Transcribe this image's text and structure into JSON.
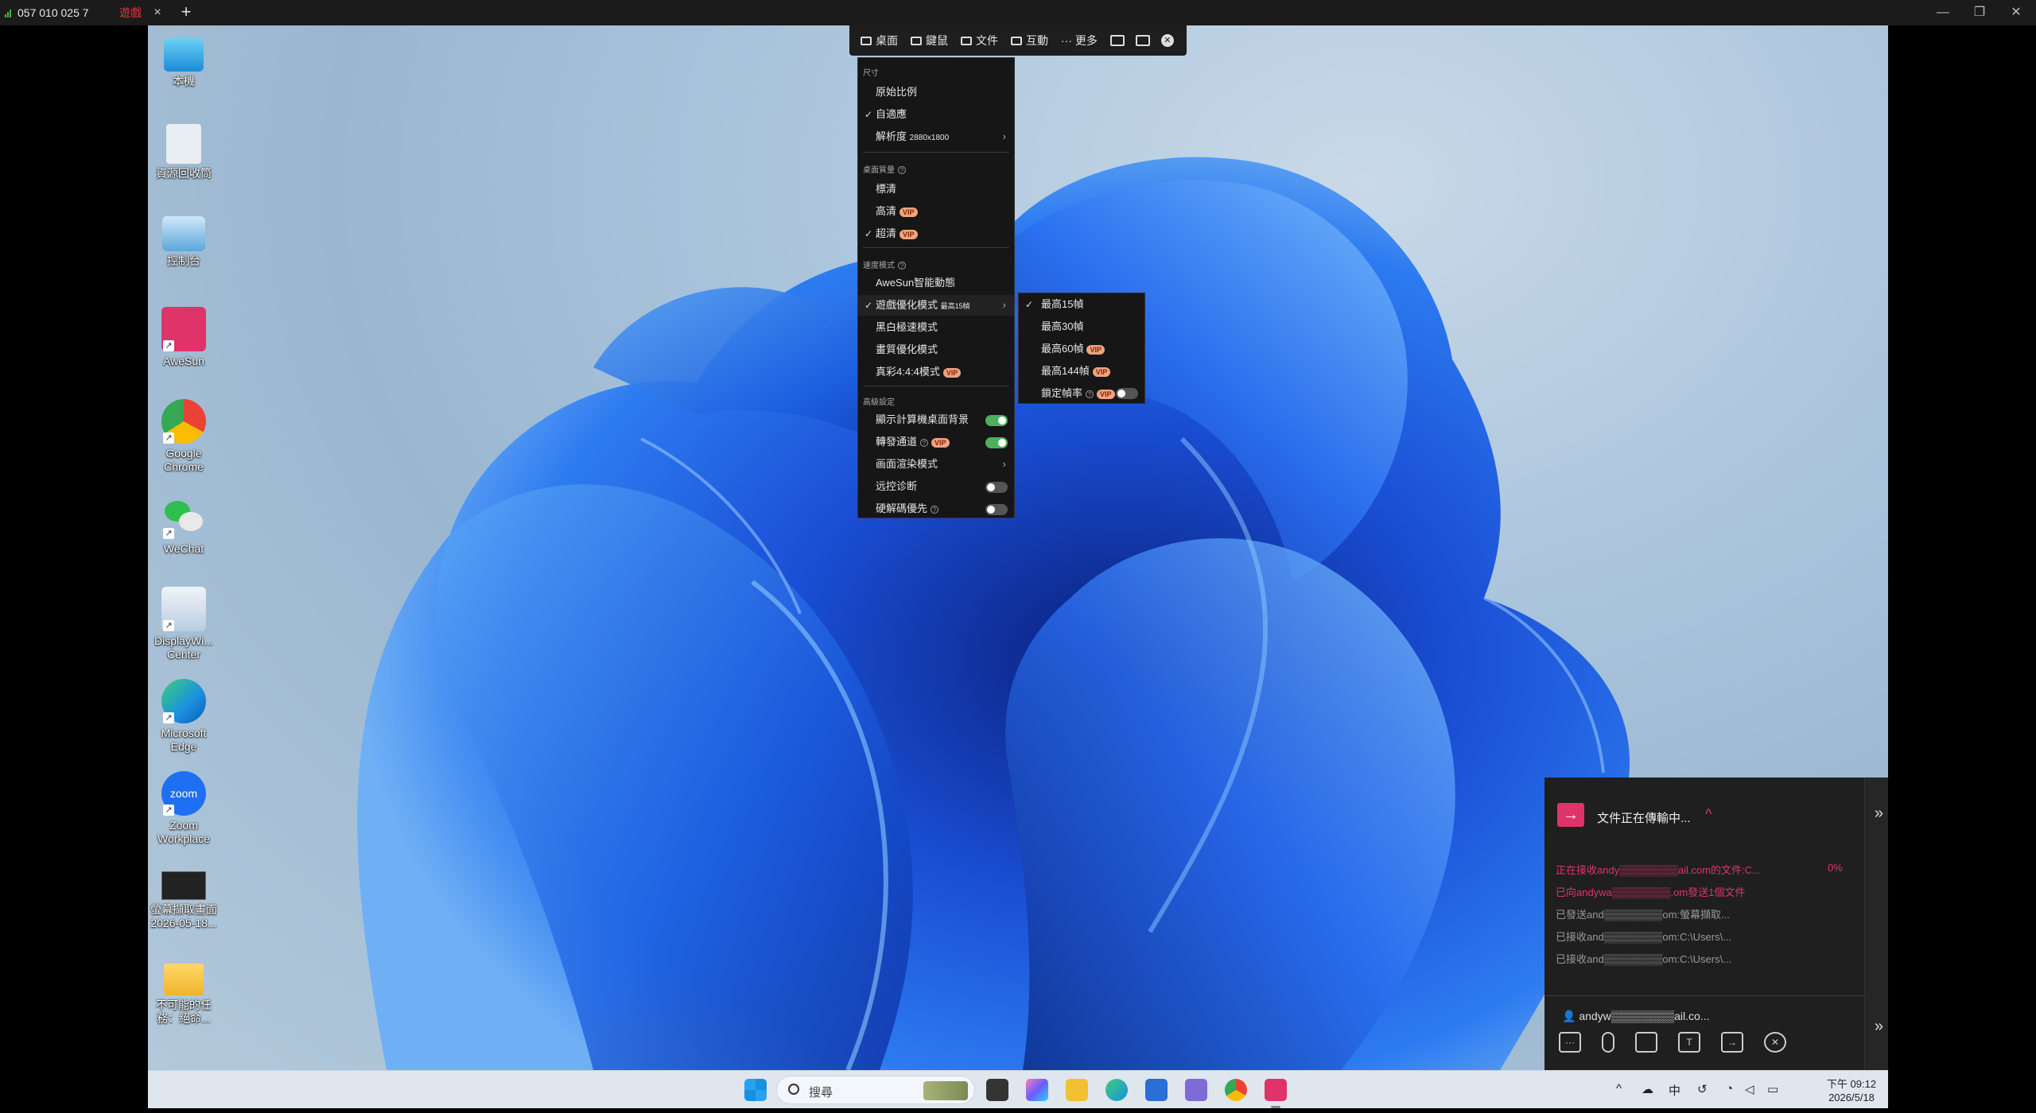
{
  "titlebar": {
    "connection_id": "057 010 025 7",
    "game_tab": "遊戲",
    "close_tab": "×",
    "add_tab": "+",
    "minimize": "—",
    "restore": "❐",
    "close": "✕"
  },
  "toolbar": {
    "desktop": "桌面",
    "keyboard": "鍵鼠",
    "file": "文件",
    "interact": "互動",
    "more": "··· 更多"
  },
  "menu": {
    "size_section": "尺寸",
    "original_ratio": "原始比例",
    "adaptive": "自適應",
    "resolution": "解析度",
    "resolution_value": "2880x1800",
    "quality_section": "桌面質量",
    "standard": "標清",
    "hd": "高清",
    "ultra_hd": "超清",
    "vip": "VIP",
    "speed_section": "速度模式",
    "awesun_smart": "AweSun智能動態",
    "game_mode": "遊戲優化模式",
    "game_mode_value": "最高15幀",
    "bw_mode": "黑白極速模式",
    "quality_mode": "畫質優化模式",
    "true_color": "真彩4:4:4模式",
    "advanced_section": "高級設定",
    "show_wallpaper": "顯示計算機桌面背景",
    "relay": "轉發通道",
    "render_mode": "画面渲染模式",
    "remote_diag": "远控诊断",
    "hw_decode": "硬解碼優先",
    "check": "✓",
    "arrow": "›"
  },
  "submenu": {
    "fps15": "最高15幀",
    "fps30": "最高30幀",
    "fps60": "最高60幀",
    "fps144": "最高144幀",
    "lock_fps": "鎖定幀率"
  },
  "filetransfer": {
    "title": "文件正在傳輸中...",
    "caret": "^",
    "expand": "»",
    "line1": "正在接收andy▒▒▒▒▒▒▒▒ail.com的文件:C...",
    "line1_pct": "0%",
    "line2": "已向andywa▒▒▒▒▒▒▒▒.om發送1個文件",
    "line3": "已發送and▒▒▒▒▒▒▒▒om:螢幕擷取...",
    "line4": "已接收and▒▒▒▒▒▒▒▒om:C:\\Users\\...",
    "line5": "已接收and▒▒▒▒▒▒▒▒om:C:\\Users\\...",
    "user": "andyw▒▒▒▒▒▒▒▒ail.co...",
    "colors": {
      "accent": "#e0336a",
      "muted": "#9a9a9a"
    }
  },
  "desktop_icons": [
    {
      "label": "本機"
    },
    {
      "label": "資源回收筒"
    },
    {
      "label": "控制台"
    },
    {
      "label": "AweSun"
    },
    {
      "label": "Google Chrome"
    },
    {
      "label": "WeChat"
    },
    {
      "label": "DisplayWi... Center"
    },
    {
      "label": "Microsoft Edge"
    },
    {
      "label": "Zoom Workplace"
    },
    {
      "label": "螢幕擷取畫面 2026-05-18..."
    },
    {
      "label": "不可能的任務：絕命..."
    }
  ],
  "taskbar": {
    "search_placeholder": "搜尋",
    "ime": "中",
    "clock_time": "下午 09:12",
    "clock_date": "2026/5/18"
  }
}
